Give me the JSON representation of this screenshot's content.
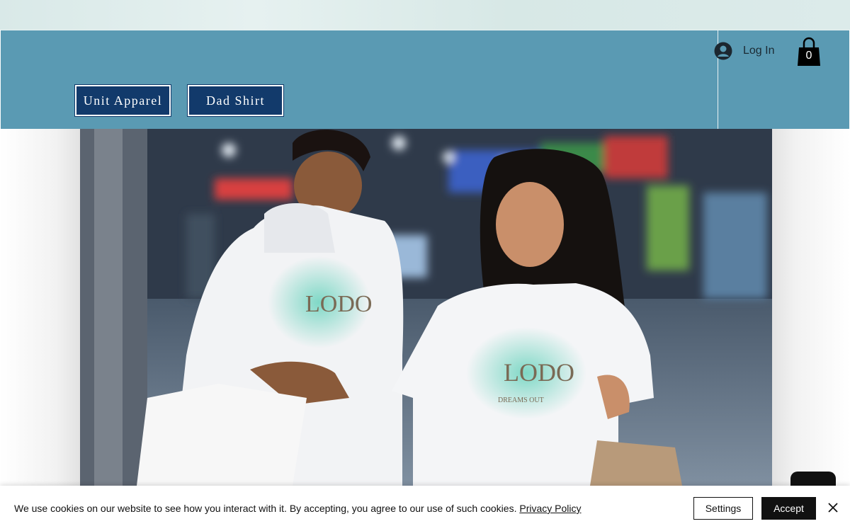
{
  "header": {
    "nav": [
      {
        "label": "Unit Apparel"
      },
      {
        "label": "Dad Shirt"
      }
    ],
    "login_label": "Log In",
    "cart_count": "0",
    "colors": {
      "header_bg": "#5a9ab3",
      "button_bg": "#123a6b"
    }
  },
  "hero": {
    "shirt_logo_letters": "LODO",
    "shirt_logo_arc": "DREAMS OUT"
  },
  "cookie_banner": {
    "message": "We use cookies on our website to see how you interact with it. By accepting, you agree to our use of such cookies.",
    "policy_link": "Privacy Policy",
    "settings_label": "Settings",
    "accept_label": "Accept"
  },
  "icons": {
    "login": "avatar-icon",
    "cart": "shopping-bag-icon",
    "close": "close-icon",
    "chat": "chat-icon"
  }
}
